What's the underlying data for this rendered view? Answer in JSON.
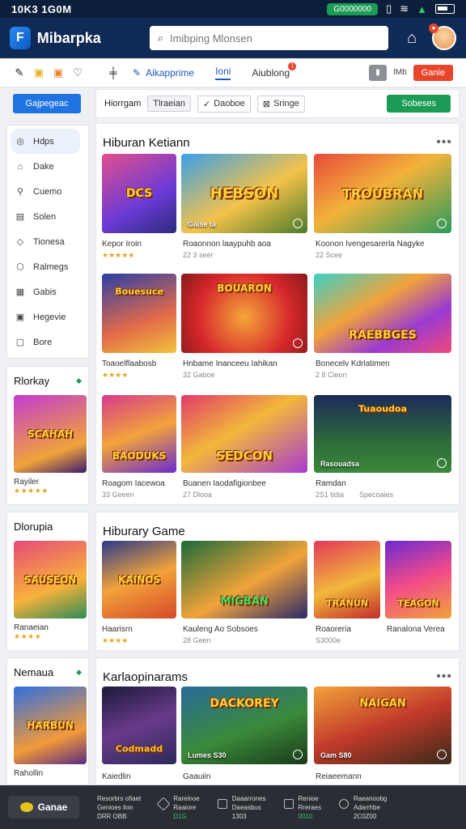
{
  "status": {
    "time": "10K3 1G0M",
    "pill": "G0000000"
  },
  "app": {
    "name": "Mibarpka"
  },
  "search": {
    "placeholder": "Imibping Mlonsen"
  },
  "toolbar": {
    "item1": "Aikapprime",
    "item2": "Ioni",
    "item3": "Aiublong",
    "item3_badge": "1",
    "right_text": "IMb",
    "red_btn": "Ganie"
  },
  "sidebar": {
    "primary_btn": "Gajpegeac",
    "items": [
      "Hdps",
      "Dake",
      "Cuemo",
      "Solen",
      "Tionesa",
      "Ralmegs",
      "Gabis",
      "Hegevie",
      "Bore"
    ]
  },
  "promo1": {
    "title": "Rlorkay",
    "name": "Rayiler",
    "banner": "SCAHAH"
  },
  "promo2": {
    "title": "Dlorupia",
    "name": "Ranaeian",
    "banner": "SAUSEON"
  },
  "promo3": {
    "title": "Nemaua",
    "name": "Rahollin",
    "banner": "HARBUN"
  },
  "filter": {
    "label": "Hiorrgam",
    "chip1": "Tlraeian",
    "chip2": "Daoboe",
    "chip3": "Sringe",
    "btn": "Sobeses"
  },
  "section1": {
    "title": "Hiburan Ketiann",
    "games": [
      {
        "caption": "Kepor Iroin",
        "sub": "",
        "banner": "DCS"
      },
      {
        "caption": "Roaonnon laaypuhb aoa",
        "sub": "22 3 seer",
        "banner": "HEBSON",
        "tag": "Gaise ta"
      },
      {
        "caption": "Koonon Ivengesarerla Nagyke",
        "sub": "22 Scee",
        "banner": "TROUBRAN"
      },
      {
        "caption": "Toaoelflaabosb",
        "sub": "",
        "banner": "Bouesuce"
      },
      {
        "caption": "Hnbame Inanceeu Iahikan",
        "sub": "32 Gaboe",
        "banner": "BOUARON"
      },
      {
        "caption": "Bonecelv Kdrlatimen",
        "sub": "2 8 Cieon",
        "banner": "RAEBBGES"
      },
      {
        "caption": "Roagom Iacewoa",
        "sub": "33 Geeen",
        "banner": "BAODUKS"
      },
      {
        "caption": "Buanen Iaodafigionbee",
        "sub": "27 Dlooa",
        "banner": "SEDCON"
      },
      {
        "caption": "Ramdan",
        "sub": "2S1 tidia",
        "sub2": "Specoaies",
        "banner": "Tuaoudoa",
        "tag": "Rasouadsa"
      }
    ]
  },
  "section2": {
    "title": "Hiburary Game",
    "games": [
      {
        "caption": "Haarisrn",
        "banner": "KAINOS"
      },
      {
        "caption": "Kauleng Ao Sobsoes",
        "sub": "28 Geen",
        "banner": "MIGBAN"
      },
      {
        "caption": "Roaoreria",
        "sub": "S3000e",
        "banner": "TRANUN"
      },
      {
        "caption": "Ranalona Verea",
        "banner": "TEAGON"
      }
    ]
  },
  "section3": {
    "title": "Karlaopinarams",
    "games": [
      {
        "caption": "Kaiedlin",
        "banner": "Codmadd"
      },
      {
        "caption": "Gaauiin",
        "banner": "DACKOREY",
        "tag": "Lumes S30"
      },
      {
        "caption": "Reiaeemann",
        "banner": "NAIGAN",
        "tag": "Gam S80"
      }
    ]
  },
  "bottombar": {
    "btn": "Ganae",
    "items": [
      {
        "l1": "Resorbrs ofiaet",
        "l2": "Genioes ilon",
        "l3": "DRR OBB"
      },
      {
        "l1": "Rareinoe",
        "l2": "Raaiore",
        "l3": "D1G"
      },
      {
        "l1": "Daaarrones",
        "l2": "Daeasbus",
        "l3": "1303"
      },
      {
        "l1": "Renioe",
        "l2": "Rreraes",
        "l3": "0010"
      },
      {
        "l1": "Raeanoobg",
        "l2": "Adarrhbe",
        "l3": "2C0Z00"
      }
    ]
  },
  "colors": {
    "navy": "#0f2a55",
    "accent": "#1e73e0",
    "green": "#1c9b54",
    "red": "#e8452c"
  }
}
